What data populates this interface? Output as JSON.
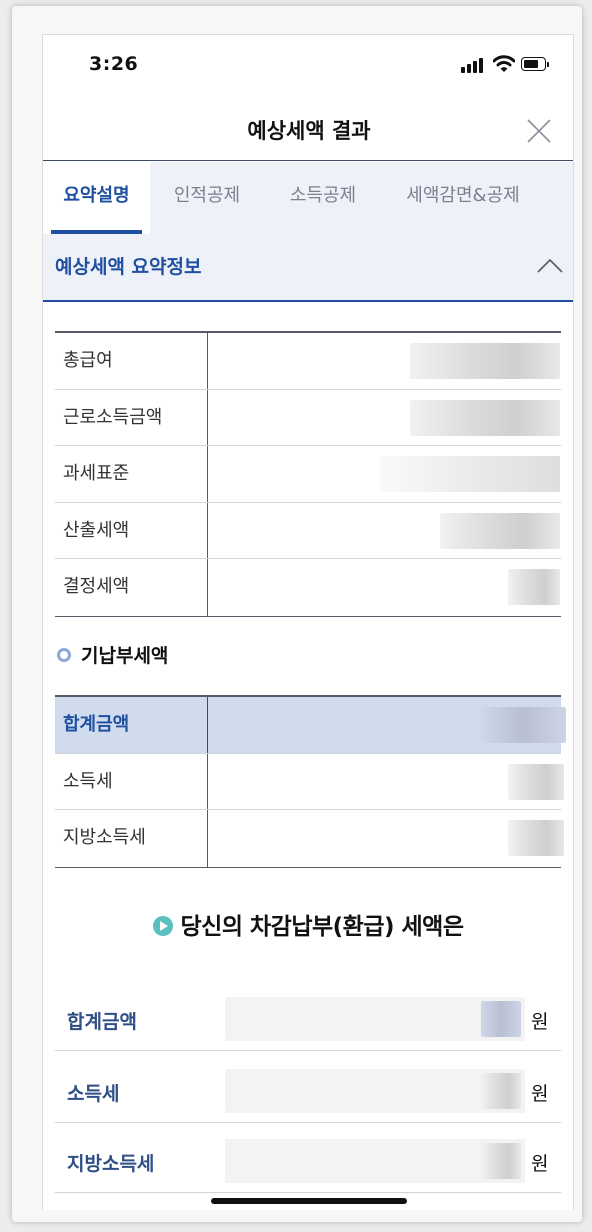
{
  "status_bar": {
    "time": "3:26"
  },
  "header": {
    "title": "예상세액 결과"
  },
  "tabs": [
    {
      "label": "요약설명",
      "active": true
    },
    {
      "label": "인적공제",
      "active": false
    },
    {
      "label": "소득공제",
      "active": false
    },
    {
      "label": "세액감면&공제",
      "active": false
    }
  ],
  "summary": {
    "title": "예상세액 요약정보",
    "rows": [
      {
        "label": "총급여"
      },
      {
        "label": "근로소득금액"
      },
      {
        "label": "과세표준"
      },
      {
        "label": "산출세액"
      },
      {
        "label": "결정세액"
      }
    ]
  },
  "prepaid": {
    "title": "기납부세액",
    "rows": [
      {
        "label": "합계금액"
      },
      {
        "label": "소득세"
      },
      {
        "label": "지방소득세"
      }
    ]
  },
  "result": {
    "title": "당신의 차감납부(환급) 세액은",
    "unit": "원",
    "rows": [
      {
        "label": "합계금액"
      },
      {
        "label": "소득세"
      },
      {
        "label": "지방소득세"
      }
    ]
  },
  "colors": {
    "accent": "#1f4fa0",
    "tab_bg": "#eef1f7",
    "highlight_row": "#d0dbee",
    "result_icon": "#5bbfc0"
  }
}
